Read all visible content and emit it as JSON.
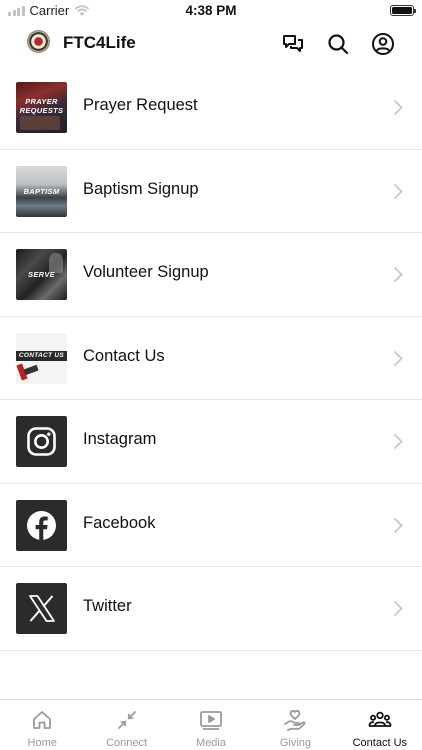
{
  "status_bar": {
    "carrier": "Carrier",
    "time": "4:38 PM"
  },
  "header": {
    "title": "FTC4Life",
    "icons": [
      "chat-bubbles-icon",
      "search-icon",
      "account-icon"
    ]
  },
  "items": [
    {
      "label": "Prayer Request",
      "thumb_text": "PRAYER REQUESTS",
      "thumb_icon": "prayer-requests-thumbnail"
    },
    {
      "label": "Baptism Signup",
      "thumb_text": "BAPTISM",
      "thumb_icon": "baptism-thumbnail"
    },
    {
      "label": "Volunteer Signup",
      "thumb_text": "SERVE",
      "thumb_icon": "serve-thumbnail"
    },
    {
      "label": "Contact Us",
      "thumb_text": "CONTACT US",
      "thumb_icon": "contact-us-thumbnail"
    },
    {
      "label": "Instagram",
      "thumb_icon": "instagram-icon"
    },
    {
      "label": "Facebook",
      "thumb_icon": "facebook-icon"
    },
    {
      "label": "Twitter",
      "thumb_icon": "x-twitter-icon"
    }
  ],
  "tabs": [
    {
      "label": "Home",
      "icon": "home-icon"
    },
    {
      "label": "Connect",
      "icon": "connect-icon"
    },
    {
      "label": "Media",
      "icon": "media-icon"
    },
    {
      "label": "Giving",
      "icon": "giving-icon"
    },
    {
      "label": "Contact Us",
      "icon": "people-icon",
      "active": true
    }
  ],
  "colors": {
    "active": "#111111",
    "inactive": "#9a9a9a",
    "divider": "#e8e8e8"
  }
}
